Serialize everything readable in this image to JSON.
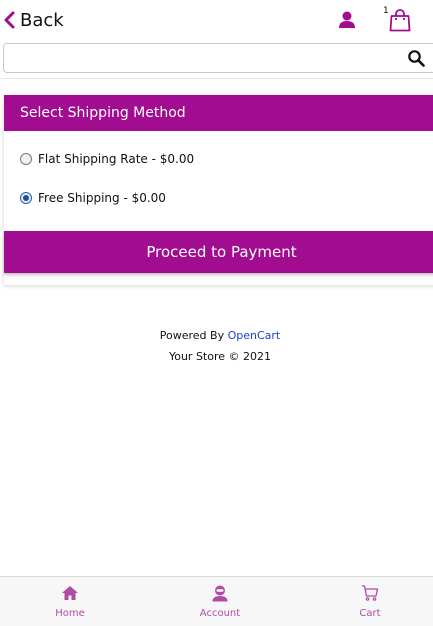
{
  "header": {
    "back_label": "Back",
    "cart_count": "1",
    "icons": [
      "chevron-left-icon",
      "user-icon",
      "shopping-bag-icon"
    ]
  },
  "search": {
    "value": "",
    "placeholder": "",
    "icon": "search-icon"
  },
  "shipping": {
    "title": "Select Shipping Method",
    "options": [
      {
        "label": "Flat Shipping Rate - $0.00",
        "checked": false
      },
      {
        "label": "Free Shipping - $0.00",
        "checked": true
      }
    ],
    "proceed_label": "Proceed to Payment"
  },
  "footer": {
    "powered_prefix": "Powered By",
    "powered_link": "OpenCart",
    "copyright": "Your Store © 2021"
  },
  "bottom_nav": {
    "items": [
      {
        "label": "Home",
        "icon": "home-icon"
      },
      {
        "label": "Account",
        "icon": "account-icon"
      },
      {
        "label": "Cart",
        "icon": "cart-icon"
      }
    ]
  },
  "colors": {
    "accent": "#a10c90",
    "nav_label": "#b04ba6",
    "link": "#1b3fd6"
  }
}
